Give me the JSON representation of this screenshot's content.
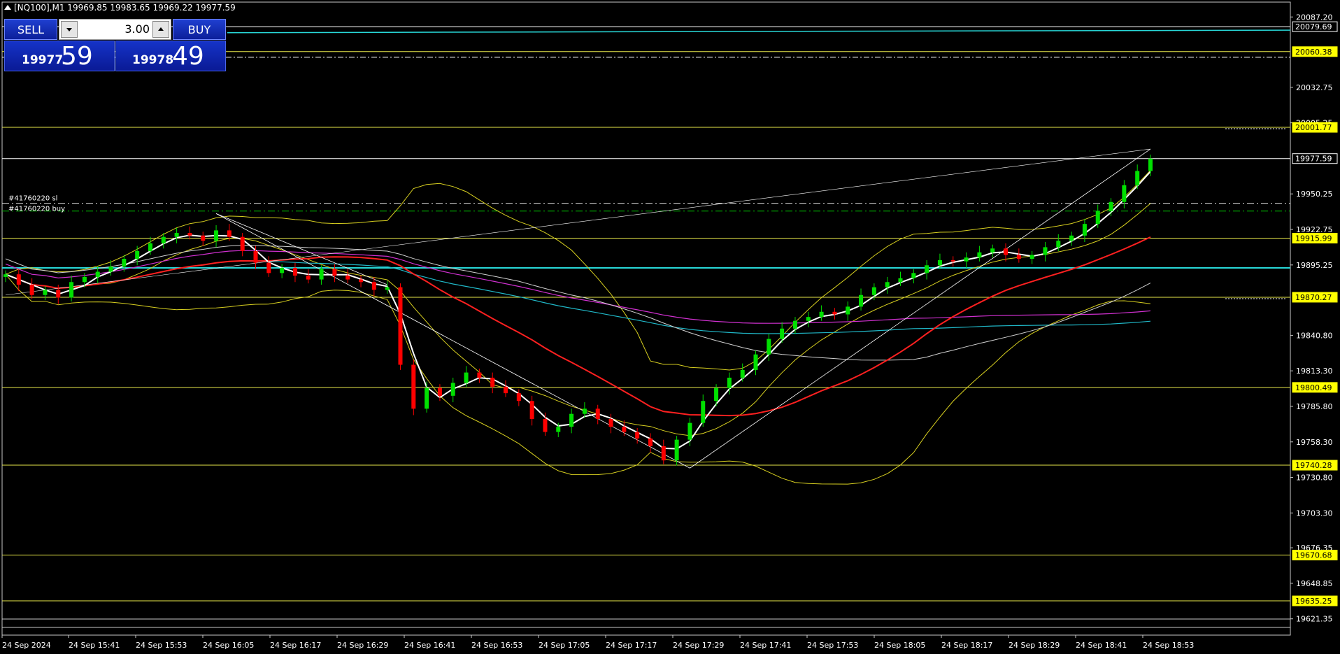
{
  "header": {
    "title": "[NQ100],M1  19969.85 19983.65 19969.22 19977.59"
  },
  "trade_panel": {
    "sell_label": "SELL",
    "buy_label": "BUY",
    "lot_value": "3.00",
    "bid_main": "19977",
    "bid_pips": "59",
    "ask_main": "19978",
    "ask_pips": "49"
  },
  "colors": {
    "background": "#000000",
    "bull_candle": "#00e000",
    "bear_candle": "#ff0000",
    "level_line": "#e8e84a",
    "cyan_line": "#28d8d8",
    "ma_white": "#ffffff",
    "ma_red": "#ff2020",
    "ma_magenta": "#d030d0",
    "ma_cyan": "#20b8c8",
    "bollinger": "#d8d020",
    "price_label_bg": "#ffff00"
  },
  "chart_data": {
    "type": "candlestick",
    "symbol": "[NQ100]",
    "timeframe": "M1",
    "ohlc_last": {
      "open": 19969.85,
      "high": 19983.65,
      "low": 19969.22,
      "close": 19977.59
    },
    "ylim": [
      19612.0,
      20096.0
    ],
    "y_ticks": [
      "20087.20",
      "20032.75",
      "20005.25",
      "19950.25",
      "19922.75",
      "19895.25",
      "19840.80",
      "19813.30",
      "19785.80",
      "19758.30",
      "19730.80",
      "19703.30",
      "19676.35",
      "19648.85",
      "19621.35"
    ],
    "x_ticks": [
      "24 Sep 2024",
      "24 Sep 15:41",
      "24 Sep 15:53",
      "24 Sep 16:05",
      "24 Sep 16:17",
      "24 Sep 16:29",
      "24 Sep 16:41",
      "24 Sep 16:53",
      "24 Sep 17:05",
      "24 Sep 17:17",
      "24 Sep 17:29",
      "24 Sep 17:41",
      "24 Sep 17:53",
      "24 Sep 18:05",
      "24 Sep 18:17",
      "24 Sep 18:29",
      "24 Sep 18:41",
      "24 Sep 18:53"
    ],
    "levels": [
      {
        "value": 20060.38,
        "label": "20060.38",
        "style": "yellow"
      },
      {
        "value": 20001.77,
        "label": "20001.77",
        "style": "yellow"
      },
      {
        "value": 19915.99,
        "label": "19915.99",
        "style": "yellow"
      },
      {
        "value": 19870.27,
        "label": "19870.27",
        "style": "yellow"
      },
      {
        "value": 19800.49,
        "label": "19800.49",
        "style": "yellow"
      },
      {
        "value": 19740.28,
        "label": "19740.28",
        "style": "yellow"
      },
      {
        "value": 19670.68,
        "label": "19670.68",
        "style": "yellow"
      },
      {
        "value": 19635.25,
        "label": "19635.25",
        "style": "yellow"
      }
    ],
    "current_price": {
      "value": 19977.59,
      "label": "19977.59"
    },
    "white_level": {
      "value": 20079.69,
      "label": "20079.69"
    },
    "order_lines": [
      {
        "label": "#41760220 sl",
        "value": 19943.0
      },
      {
        "label": "#41760220 buy",
        "value": 19937.0
      }
    ],
    "close_path": [
      19888,
      19880,
      19872,
      19876,
      19870,
      19882,
      19886,
      19890,
      19894,
      19900,
      19906,
      19912,
      19917,
      19920,
      19918,
      19914,
      19922,
      19917,
      19906,
      19897,
      19889,
      19893,
      19887,
      19884,
      19892,
      19887,
      19884,
      19882,
      19876,
      19878,
      19818,
      19784,
      19800,
      19794,
      19804,
      19812,
      19808,
      19801,
      19796,
      19790,
      19776,
      19766,
      19770,
      19780,
      19784,
      19776,
      19770,
      19766,
      19761,
      19755,
      19744,
      19760,
      19773,
      19790,
      19800,
      19808,
      19814,
      19826,
      19838,
      19846,
      19852,
      19855,
      19859,
      19857,
      19863,
      19872,
      19878,
      19882,
      19885,
      19889,
      19895,
      19899,
      19898,
      19901,
      19905,
      19908,
      19903,
      19900,
      19903,
      19909,
      19914,
      19918,
      19927,
      19937,
      19944,
      19957,
      19968,
      19977.59
    ]
  }
}
